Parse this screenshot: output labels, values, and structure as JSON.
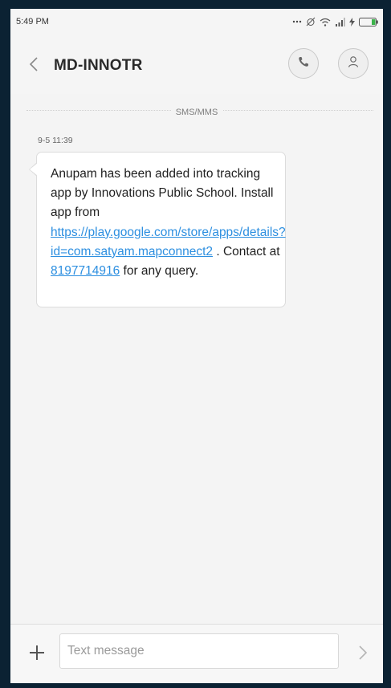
{
  "status_bar": {
    "time": "5:49 PM",
    "icons": [
      "more-dots-icon",
      "alarm-off-icon",
      "wifi-icon",
      "signal-icon",
      "charging-icon",
      "battery-icon"
    ]
  },
  "header": {
    "contact_name": "MD-INNOTR",
    "icons": [
      "back-icon",
      "phone-call-icon",
      "contact-person-icon"
    ]
  },
  "thread": {
    "separator_label": "SMS/MMS",
    "message": {
      "timestamp": "9-5 11:39",
      "text_before_link": "Anupam has been added into tracking app by Innovations Public School. Install app from ",
      "link_url": "https://play.google.com/store/apps/details?id=com.satyam.mapconnect2",
      "text_between": " . Contact at ",
      "phone_number": "8197714916",
      "text_after": " for any query."
    }
  },
  "composer": {
    "placeholder": "Text message",
    "icons": [
      "plus-icon",
      "send-icon"
    ]
  },
  "colors": {
    "link": "#2d8fe0",
    "background": "#f4f4f4",
    "bubble": "#ffffff"
  }
}
